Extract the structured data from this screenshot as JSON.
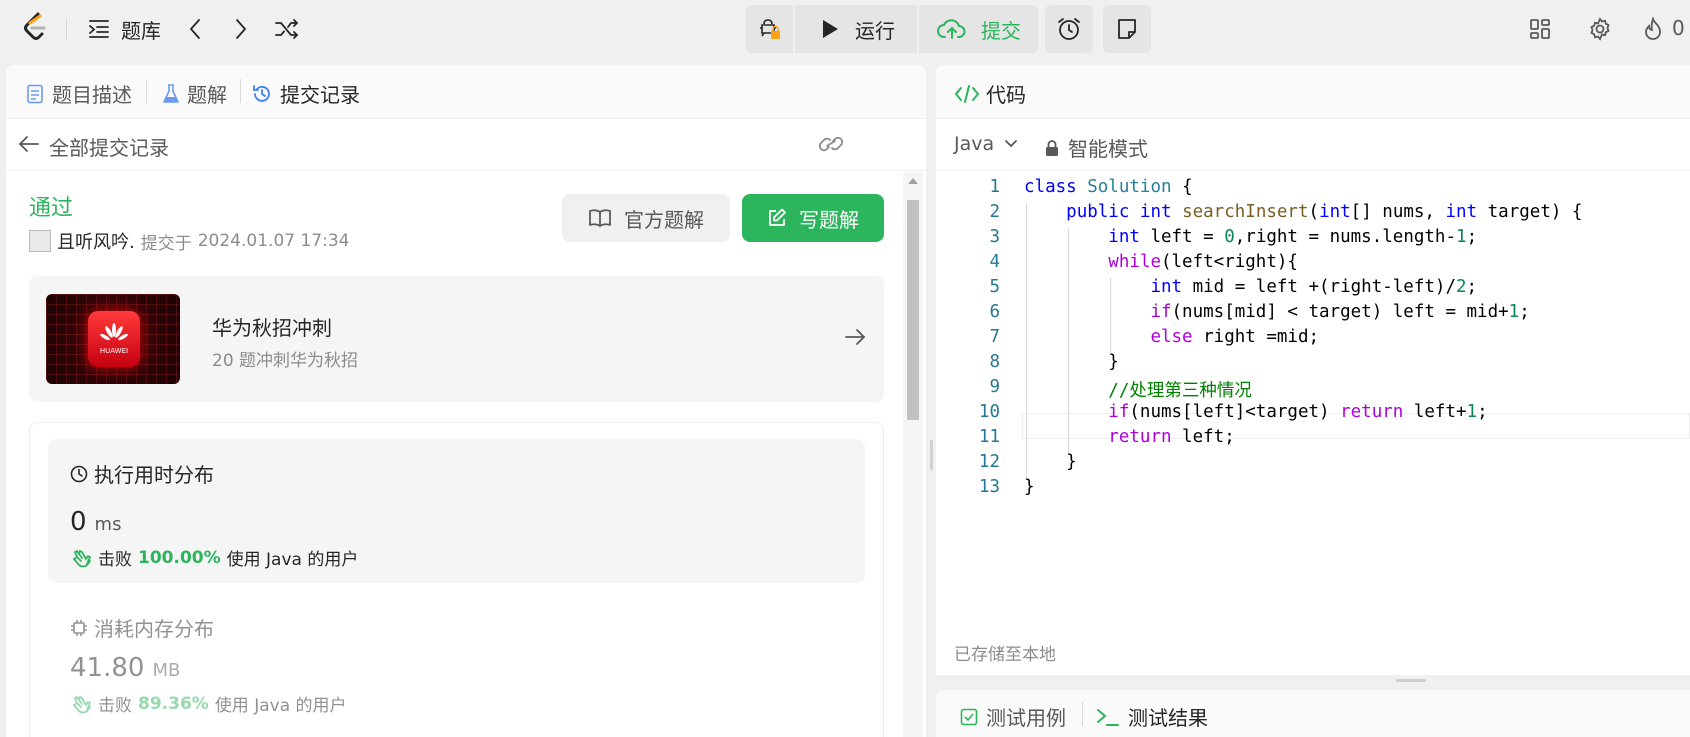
{
  "topbar": {
    "problem_bank_label": "题库",
    "run_label": "运行",
    "submit_label": "提交",
    "fire_count": "0"
  },
  "left_tabs": [
    {
      "label": "题目描述"
    },
    {
      "label": "题解"
    },
    {
      "label": "提交记录"
    }
  ],
  "subheader": {
    "back_label": "全部提交记录"
  },
  "submission": {
    "status": "通过",
    "user": "且听风吟.",
    "submitted_prefix": "提交于",
    "submitted_time": "2024.01.07 17:34",
    "official_solution_label": "官方题解",
    "write_solution_label": "写题解"
  },
  "promo": {
    "title": "华为秋招冲刺",
    "subtitle": "20 题冲刺华为秋招",
    "logo_text": "HUAWEI"
  },
  "runtime": {
    "title": "执行用时分布",
    "value": "0",
    "unit": "ms",
    "beat_prefix": "击败",
    "beat_pct": "100.00%",
    "beat_suffix": "使用 Java 的用户"
  },
  "memory": {
    "title": "消耗内存分布",
    "value": "41.80",
    "unit": "MB",
    "beat_prefix": "击败",
    "beat_pct": "89.36%",
    "beat_suffix": "使用 Java 的用户"
  },
  "code_panel": {
    "title": "代码",
    "language": "Java",
    "mode": "智能模式",
    "saved_status": "已存储至本地",
    "line_numbers": [
      "1",
      "2",
      "3",
      "4",
      "5",
      "6",
      "7",
      "8",
      "9",
      "10",
      "11",
      "12",
      "13"
    ]
  },
  "bottom_tabs": [
    {
      "label": "测试用例"
    },
    {
      "label": "测试结果"
    }
  ],
  "colors": {
    "accent_green": "#2db55d",
    "keyword_blue": "#0000ff",
    "keyword_purple": "#af00db",
    "type_teal": "#267f99",
    "number_green": "#098658",
    "comment_green": "#008000",
    "line_number": "#237893"
  }
}
